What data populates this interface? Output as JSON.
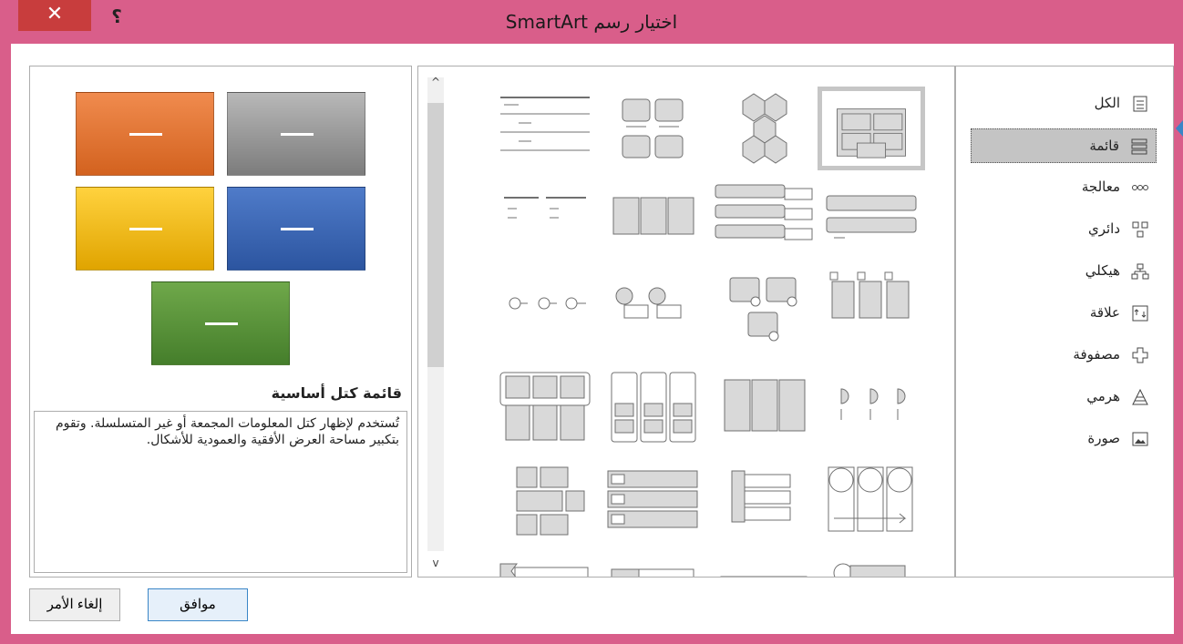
{
  "window": {
    "title": "اختيار رسم SmartArt",
    "close_glyph": "✕",
    "help_glyph": "؟",
    "accent_color": "#d95e8a",
    "close_color": "#c83d3d"
  },
  "categories": [
    {
      "label": "الكل",
      "icon": "all-icon"
    },
    {
      "label": "قائمة",
      "icon": "list-icon",
      "selected": true
    },
    {
      "label": "معالجة",
      "icon": "process-icon"
    },
    {
      "label": "دائري",
      "icon": "cycle-icon"
    },
    {
      "label": "هيكلي",
      "icon": "hierarchy-icon"
    },
    {
      "label": "علاقة",
      "icon": "relationship-icon"
    },
    {
      "label": "مصفوفة",
      "icon": "matrix-icon"
    },
    {
      "label": "هرمي",
      "icon": "pyramid-icon"
    },
    {
      "label": "صورة",
      "icon": "picture-icon"
    }
  ],
  "gallery": {
    "selected_index": 0,
    "scroll_up": "^",
    "scroll_down": "v"
  },
  "preview": {
    "name": "قائمة كتل أساسية",
    "description": "تُستخدم لإظهار كتل المعلومات المجمعة أو غير المتسلسلة. وتقوم بتكبير مساحة العرض الأفقية والعمودية للأشكال.",
    "colors": [
      "#e07030",
      "#9a9a9a",
      "#f0b818",
      "#3a66b4",
      "#5a9238"
    ]
  },
  "buttons": {
    "ok": "موافق",
    "cancel": "إلغاء الأمر"
  }
}
